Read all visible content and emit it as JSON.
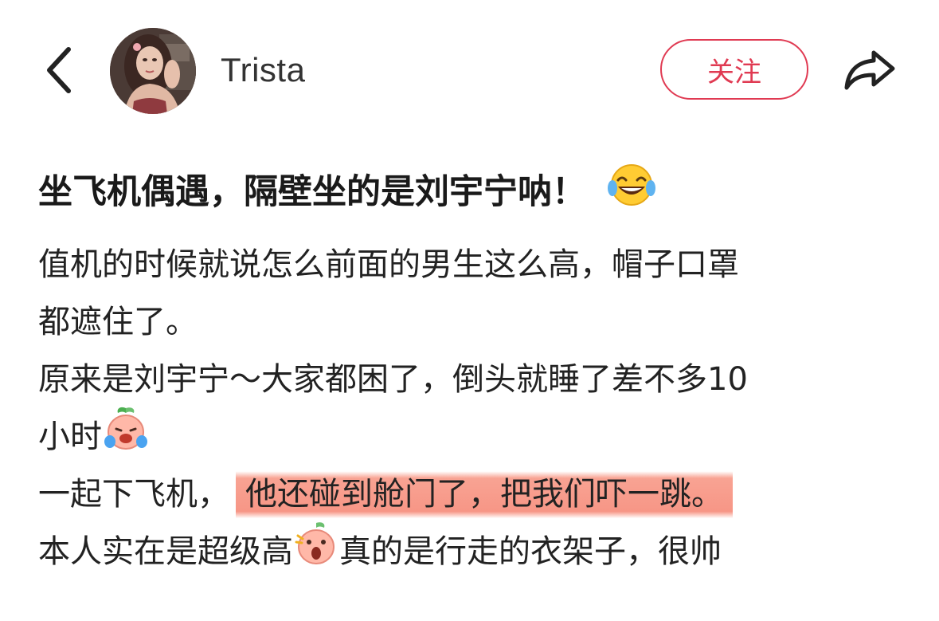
{
  "header": {
    "back_icon": "chevron-left-icon",
    "username": "Trista",
    "follow_label": "关注",
    "share_icon": "share-arrow-icon",
    "accent_color": "#e03a52"
  },
  "post": {
    "title": "坐飞机偶遇，隔壁坐的是刘宇宁呐！",
    "title_emoji": "tears-of-joy-emoji",
    "lines": {
      "l1": "值机的时候就说怎么前面的男生这么高，帽子口罩",
      "l2": "都遮住了。",
      "l3": "原来是刘宇宁～大家都困了，倒头就睡了差不多10",
      "l4": "小时",
      "l5_pre": "一起下飞机，",
      "l5_highlight": "他还碰到舱门了，把我们吓一跳。",
      "l6_pre": "本人实在是超级高",
      "l6_post": "真的是行走的衣架子，很帅"
    },
    "highlight_color": "#f79686"
  }
}
